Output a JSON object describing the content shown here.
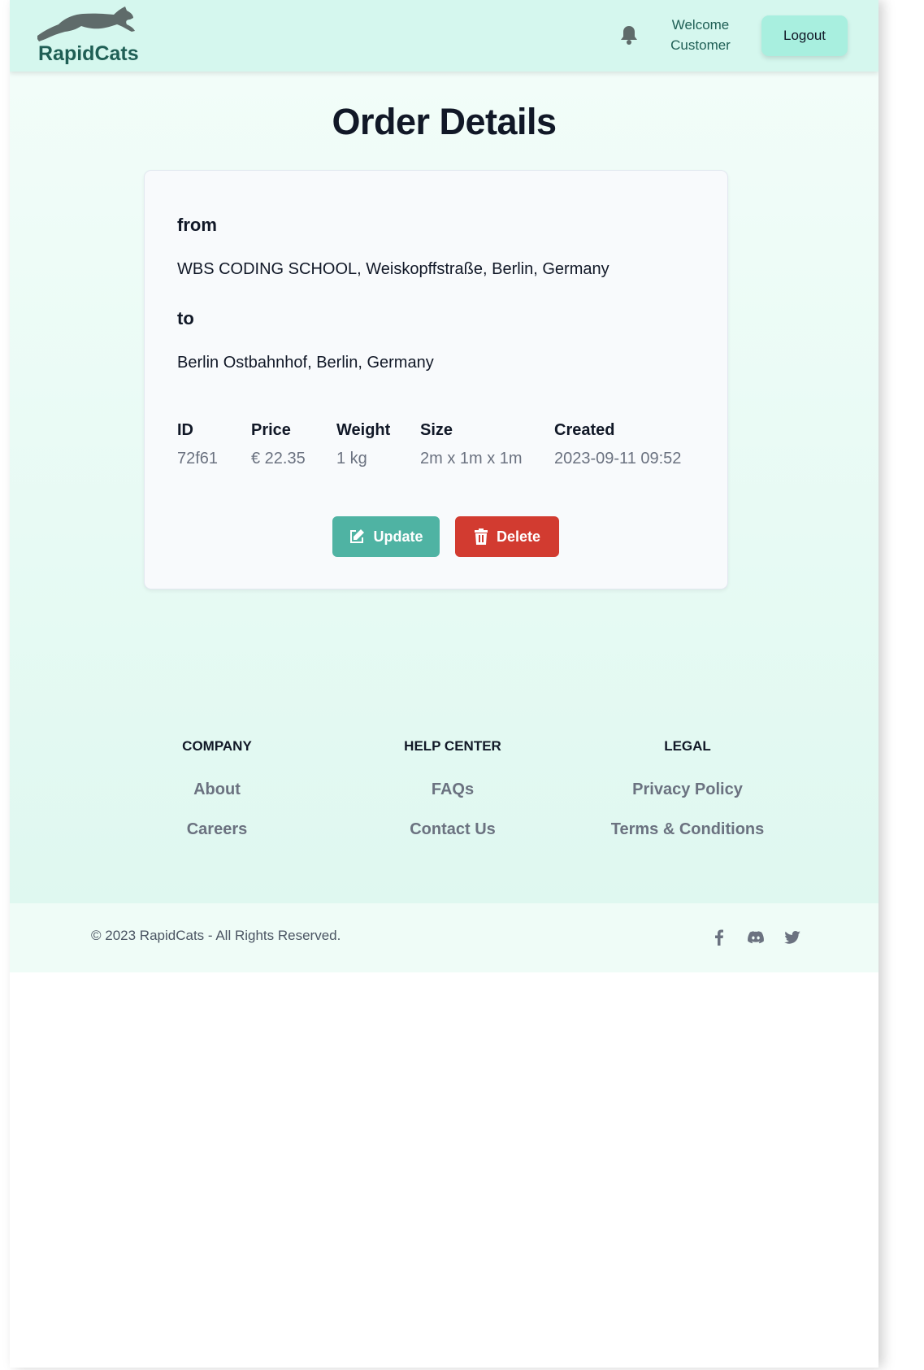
{
  "header": {
    "brand": "RapidCats",
    "logo_icon": "leaping-cat-icon",
    "notification_icon": "bell-icon",
    "welcome_line1": "Welcome",
    "welcome_line2": "Customer",
    "logout_label": "Logout"
  },
  "main": {
    "title": "Order Details",
    "from_label": "from",
    "from_address": "WBS CODING SCHOOL, Weiskopffstraße, Berlin, Germany",
    "to_label": "to",
    "to_address": "Berlin Ostbahnhof, Berlin, Germany",
    "details": [
      {
        "header": "ID",
        "value": "72f61"
      },
      {
        "header": "Price",
        "value": "€ 22.35"
      },
      {
        "header": "Weight",
        "value": "1 kg"
      },
      {
        "header": "Size",
        "value": "2m x 1m x 1m"
      },
      {
        "header": "Created",
        "value": "2023-09-11 09:52"
      }
    ],
    "update_label": "Update",
    "delete_label": "Delete"
  },
  "footer": {
    "columns": [
      {
        "heading": "COMPANY",
        "links": [
          "About",
          "Careers"
        ]
      },
      {
        "heading": "HELP CENTER",
        "links": [
          "FAQs",
          "Contact Us"
        ]
      },
      {
        "heading": "LEGAL",
        "links": [
          "Privacy Policy",
          "Terms & Conditions"
        ]
      }
    ],
    "copyright": "© 2023 RapidCats - All Rights Reserved.",
    "social_icons": [
      "facebook-icon",
      "discord-icon",
      "twitter-icon"
    ]
  },
  "colors": {
    "header_bg": "#d5f7ee",
    "brand": "#1f5f55",
    "update_button": "#4fb3a3",
    "delete_button": "#d23b30",
    "logout_button": "#a8efdf"
  }
}
